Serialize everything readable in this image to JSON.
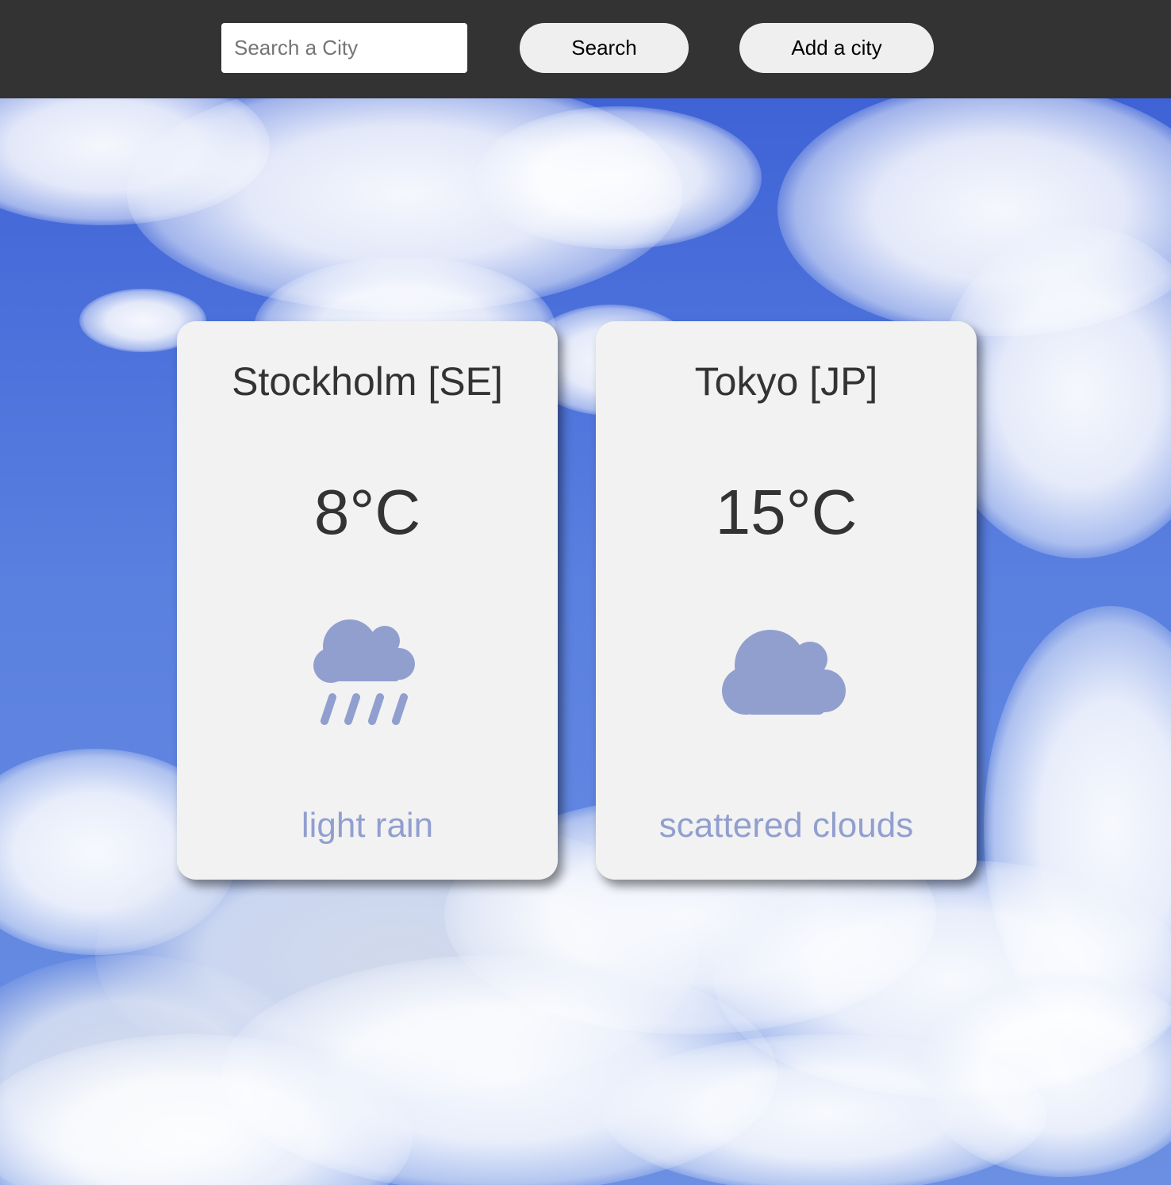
{
  "header": {
    "search_placeholder": "Search a City",
    "search_value": "",
    "search_button_label": "Search",
    "add_city_button_label": "Add a city"
  },
  "cards": [
    {
      "city": "Stockholm [SE]",
      "temperature": "8°C",
      "icon": "rain-cloud-icon",
      "description": "light rain"
    },
    {
      "city": "Tokyo [JP]",
      "temperature": "15°C",
      "icon": "cloud-icon",
      "description": "scattered clouds"
    }
  ],
  "colors": {
    "topbar": "#333333",
    "card_background": "#f2f2f2",
    "icon_and_description": "#919fcf",
    "text": "#333333"
  }
}
